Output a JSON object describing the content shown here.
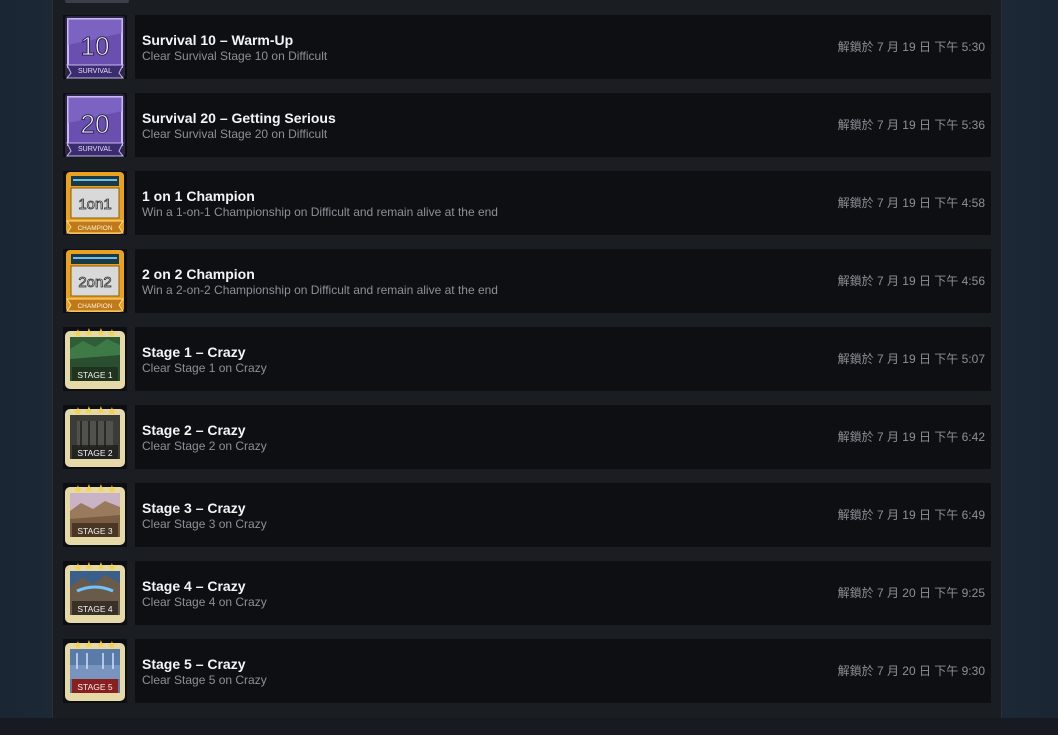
{
  "achievements": [
    {
      "title": "Survival 10 – Warm-Up",
      "description": "Clear Survival Stage 10 on Difficult",
      "unlock_time": "解鎖於 7 月 19 日 下午 5:30",
      "icon": "survival-10-badge-icon",
      "badge_number": "10",
      "badge_label": "SURVIVAL"
    },
    {
      "title": "Survival 20 – Getting Serious",
      "description": "Clear Survival Stage 20 on Difficult",
      "unlock_time": "解鎖於 7 月 19 日 下午 5:36",
      "icon": "survival-20-badge-icon",
      "badge_number": "20",
      "badge_label": "SURVIVAL"
    },
    {
      "title": "1 on 1 Champion",
      "description": "Win a 1-on-1 Championship on Difficult and remain alive at the end",
      "unlock_time": "解鎖於 7 月 19 日 下午 4:58",
      "icon": "champion-1on1-badge-icon",
      "badge_number": "1on1",
      "badge_label": "CHAMPION"
    },
    {
      "title": "2 on 2 Champion",
      "description": "Win a 2-on-2 Championship on Difficult and remain alive at the end",
      "unlock_time": "解鎖於 7 月 19 日 下午 4:56",
      "icon": "champion-2on2-badge-icon",
      "badge_number": "2on2",
      "badge_label": "CHAMPION"
    },
    {
      "title": "Stage 1 – Crazy",
      "description": "Clear Stage 1 on Crazy",
      "unlock_time": "解鎖於 7 月 19 日 下午 5:07",
      "icon": "stage-1-badge-icon",
      "badge_label": "STAGE 1"
    },
    {
      "title": "Stage 2 – Crazy",
      "description": "Clear Stage 2 on Crazy",
      "unlock_time": "解鎖於 7 月 19 日 下午 6:42",
      "icon": "stage-2-badge-icon",
      "badge_label": "STAGE 2"
    },
    {
      "title": "Stage 3 – Crazy",
      "description": "Clear Stage 3 on Crazy",
      "unlock_time": "解鎖於 7 月 19 日 下午 6:49",
      "icon": "stage-3-badge-icon",
      "badge_label": "STAGE 3"
    },
    {
      "title": "Stage 4 – Crazy",
      "description": "Clear Stage 4 on Crazy",
      "unlock_time": "解鎖於 7 月 20 日 下午 9:25",
      "icon": "stage-4-badge-icon",
      "badge_label": "STAGE 4"
    },
    {
      "title": "Stage 5 – Crazy",
      "description": "Clear Stage 5 on Crazy",
      "unlock_time": "解鎖於 7 月 20 日 下午 9:30",
      "icon": "stage-5-badge-icon",
      "badge_label": "STAGE 5"
    }
  ],
  "colors": {
    "page_bg": "#1b2838",
    "panel_bg": "#1a1d22",
    "card_bg": "#0d0f13",
    "title": "#f2f4f5",
    "muted": "#8c9097",
    "survival": "#6a4fb0",
    "champion": "#e8a21f"
  }
}
